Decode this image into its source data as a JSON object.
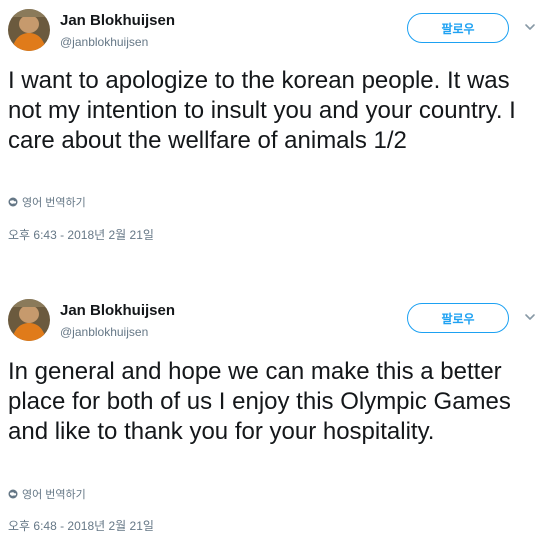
{
  "tweets": [
    {
      "author": "Jan Blokhuijsen",
      "handle": "@janblokhuijsen",
      "follow_label": "팔로우",
      "text": "I want to apologize to the korean people. It was not my intention to insult you and your country. I care about the wellfare of animals 1/2",
      "translate_label": "영어 번역하기",
      "timestamp": "오후 6:43 - 2018년 2월 21일"
    },
    {
      "author": "Jan Blokhuijsen",
      "handle": "@janblokhuijsen",
      "follow_label": "팔로우",
      "text": "In general and hope we can make this a better place for both of us I enjoy this Olympic Games and like to thank you for your hospitality.",
      "translate_label": "영어 번역하기",
      "timestamp": "오후 6:48 - 2018년 2월 21일"
    }
  ],
  "icons": {
    "globe": "globe-icon",
    "chevron": "chevron-down-icon"
  },
  "colors": {
    "accent": "#1da1f2",
    "text": "#14171a",
    "muted": "#657786"
  }
}
